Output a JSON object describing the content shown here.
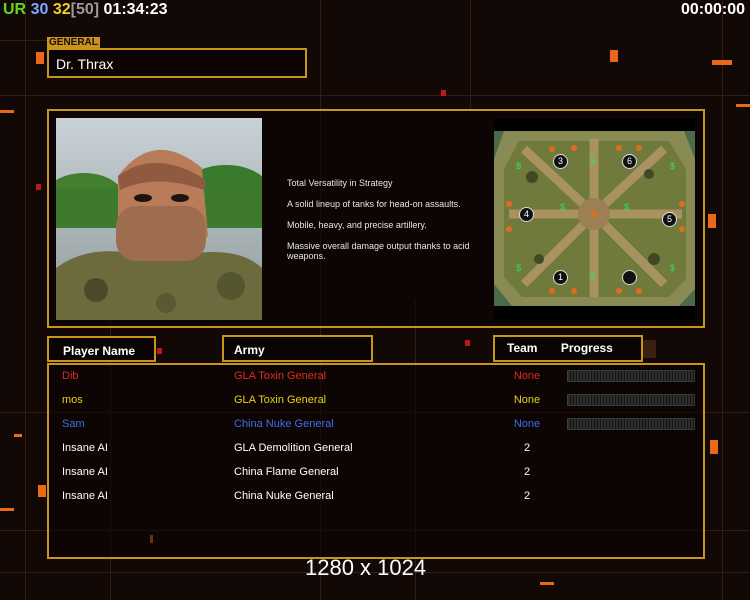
{
  "hud": {
    "ur": "UR",
    "v30": "30",
    "v32": "32",
    "v50": "[50]",
    "time": "01:34:23",
    "timer": "00:00:00"
  },
  "general": {
    "tag": "GENERAL",
    "name": "Dr. Thrax",
    "features": [
      "Total Versatility in Strategy",
      "A solid lineup of tanks for head-on assaults.",
      "Mobile, heavy, and precise artillery.",
      "Massive overall damage output thanks to acid weapons."
    ]
  },
  "map": {
    "slots": [
      "1",
      "2",
      "3",
      "4",
      "5",
      "6"
    ]
  },
  "table": {
    "headers": {
      "player": "Player Name",
      "army": "Army",
      "team": "Team",
      "progress": "Progress"
    },
    "rows": [
      {
        "player": "Dib",
        "army": "GLA Toxin General",
        "team": "None",
        "color": "#e32a1e",
        "progress": 0
      },
      {
        "player": "mos",
        "army": "GLA Toxin General",
        "team": "None",
        "color": "#e6d21c",
        "progress": 0
      },
      {
        "player": "Sam",
        "army": "China Nuke General",
        "team": "None",
        "color": "#3f6df0",
        "progress": 0
      },
      {
        "player": "Insane AI",
        "army": "GLA Demolition General",
        "team": "2",
        "color": "#ffffff"
      },
      {
        "player": "Insane AI",
        "army": "China Flame General",
        "team": "2",
        "color": "#ffffff"
      },
      {
        "player": "Insane AI",
        "army": "China Nuke General",
        "team": "2",
        "color": "#ffffff"
      }
    ]
  },
  "resolution": "1280 x 1024",
  "colors": {
    "accent": "#c8941e",
    "orange": "#e8691c"
  }
}
